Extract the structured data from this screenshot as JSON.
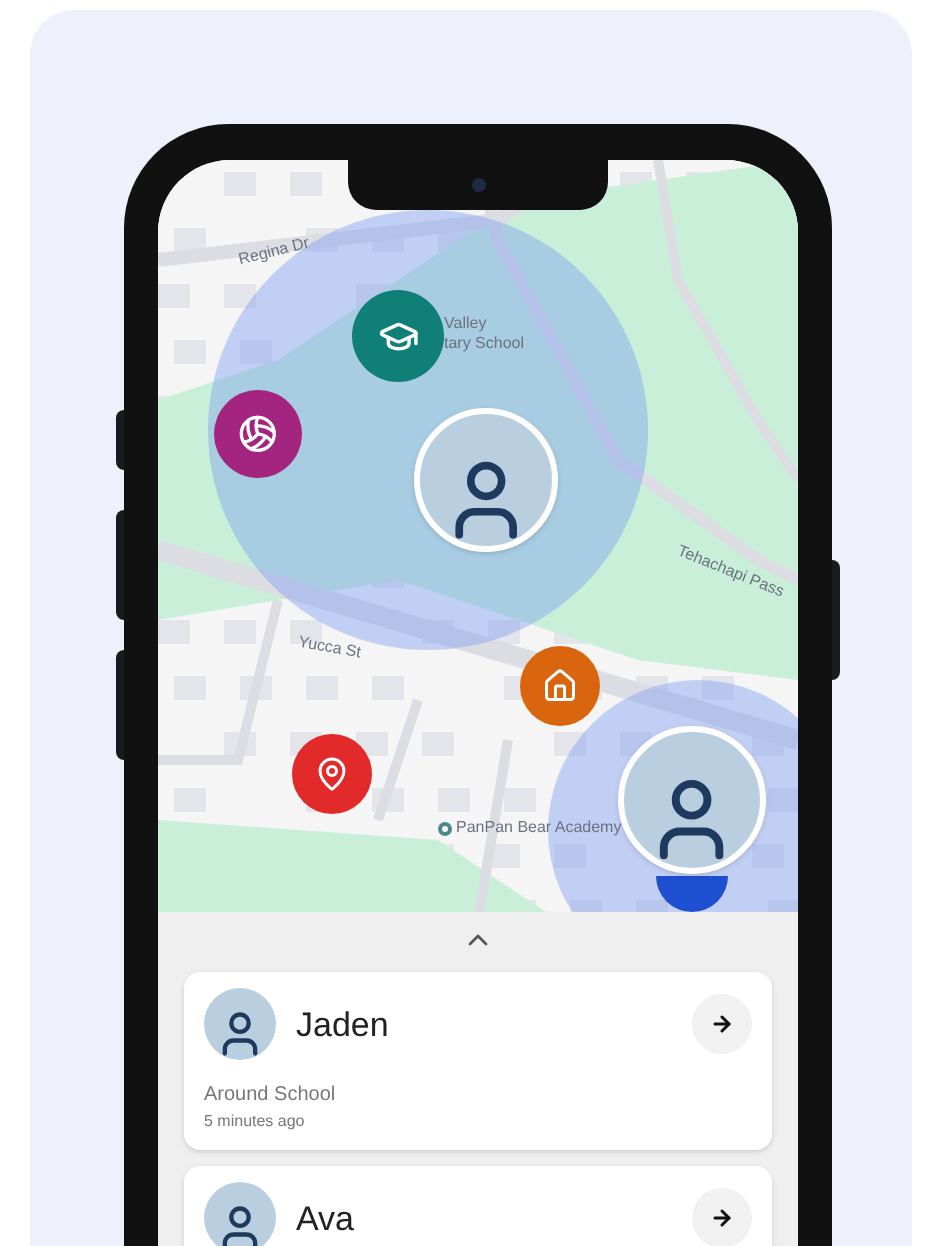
{
  "map": {
    "labels": [
      {
        "text": "Regina Dr",
        "kind": "street"
      },
      {
        "text": "Valley",
        "kind": "place"
      },
      {
        "text": "tary School",
        "kind": "place"
      },
      {
        "text": "Yucca St",
        "kind": "street"
      },
      {
        "text": "PanPan Bear Academy",
        "kind": "poi"
      },
      {
        "text": "Tehachapi Pass",
        "kind": "street"
      }
    ],
    "markers": [
      {
        "kind": "school",
        "color": "#0f7f78"
      },
      {
        "kind": "sports",
        "color": "#a3257f"
      },
      {
        "kind": "person"
      },
      {
        "kind": "home",
        "color": "#d9650f"
      },
      {
        "kind": "pin",
        "color": "#e22a2a"
      },
      {
        "kind": "pin-blue",
        "color": "#1f4fd1"
      },
      {
        "kind": "person"
      }
    ]
  },
  "people": [
    {
      "name": "Jaden",
      "place": "Around School",
      "time": "5 minutes ago"
    },
    {
      "name": "Ava"
    }
  ]
}
